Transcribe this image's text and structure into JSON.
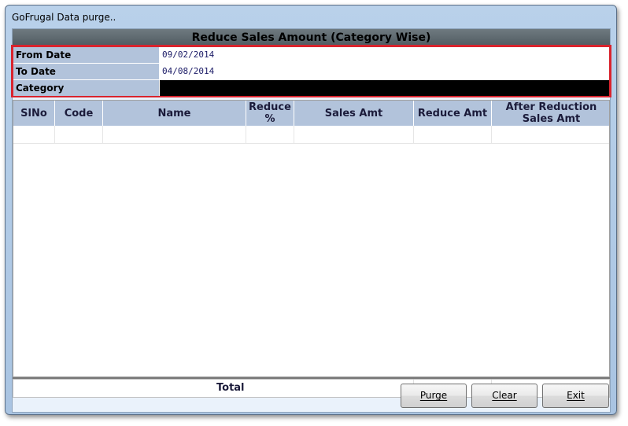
{
  "window": {
    "title": "GoFrugal Data purge.."
  },
  "heading": "Reduce Sales Amount (Category Wise)",
  "params": {
    "from_date_label": "From Date",
    "from_date_value": "09/02/2014",
    "to_date_label": "To Date",
    "to_date_value": "04/08/2014",
    "category_label": "Category",
    "category_value": ""
  },
  "grid": {
    "columns": [
      "SlNo",
      "Code",
      "Name",
      "Reduce %",
      "Sales Amt",
      "Reduce Amt",
      "After Reduction Sales Amt"
    ]
  },
  "totals": {
    "label": "Total"
  },
  "buttons": {
    "purge": "Purge",
    "clear": "Clear",
    "exit": "Exit"
  }
}
